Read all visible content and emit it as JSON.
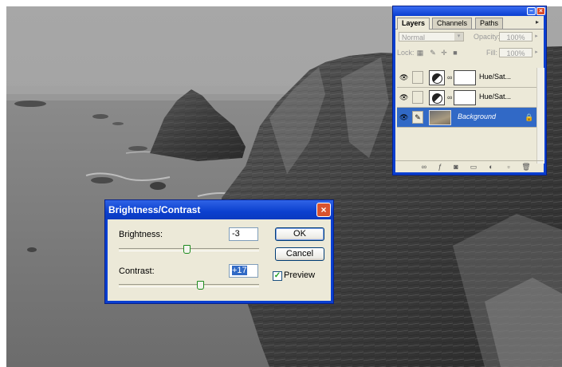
{
  "layers_panel": {
    "tabs": [
      "Layers",
      "Channels",
      "Paths"
    ],
    "blend_mode": "Normal",
    "opacity_label": "Opacity:",
    "opacity_value": "100%",
    "lock_label": "Lock:",
    "fill_label": "Fill:",
    "fill_value": "100%",
    "layers": [
      {
        "name": "Hue/Sat...",
        "visible": true,
        "selected": false
      },
      {
        "name": "Hue/Sat...",
        "visible": true,
        "selected": false
      },
      {
        "name": "Background",
        "visible": true,
        "selected": true
      }
    ],
    "selected_color": "#3169c6"
  },
  "dialog": {
    "title": "Brightness/Contrast",
    "brightness_label": "Brightness:",
    "brightness_value": "-3",
    "contrast_label": "Contrast:",
    "contrast_value": "+17",
    "ok_label": "OK",
    "cancel_label": "Cancel",
    "preview_label": "Preview",
    "preview_checked": true,
    "brightness_slider_level": -3,
    "contrast_slider_level": 17
  },
  "theme": {
    "titlebar_blue": "#0a3fd0",
    "panel_bg": "#ece9d8",
    "close_red": "#d9532f"
  }
}
